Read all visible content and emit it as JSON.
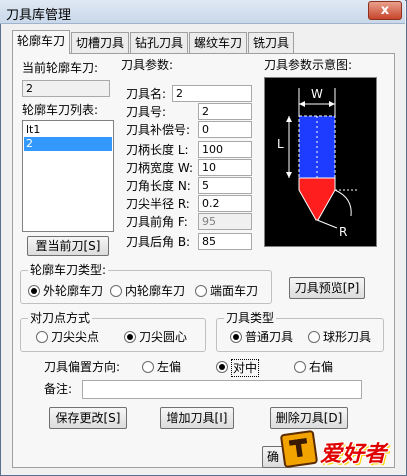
{
  "window": {
    "title": "刀具库管理",
    "close_glyph": "x"
  },
  "tabs": [
    {
      "label": "轮廓车刀"
    },
    {
      "label": "切槽刀具"
    },
    {
      "label": "钻孔刀具"
    },
    {
      "label": "螺纹车刀"
    },
    {
      "label": "铣刀具"
    }
  ],
  "current_tool": {
    "label": "当前轮廓车刀:",
    "value": "2"
  },
  "tool_list": {
    "label": "轮廓车刀列表:",
    "items": [
      "lt1",
      "2"
    ],
    "selected_index": 1
  },
  "set_current_button": "置当前刀[S]",
  "params": {
    "label": "刀具参数:",
    "fields": [
      {
        "label": "刀具名:",
        "value": "2",
        "disabled": false
      },
      {
        "label": "刀具号:",
        "value": "2",
        "disabled": false
      },
      {
        "label": "刀具补偿号:",
        "value": "0",
        "disabled": false
      },
      {
        "label": "刀柄长度 L:",
        "value": "100",
        "disabled": false
      },
      {
        "label": "刀柄宽度 W:",
        "value": "10",
        "disabled": false
      },
      {
        "label": "刀角长度 N:",
        "value": "5",
        "disabled": false
      },
      {
        "label": "刀尖半径 R:",
        "value": "0.2",
        "disabled": false
      },
      {
        "label": "刀具前角 F:",
        "value": "95",
        "disabled": true
      },
      {
        "label": "刀具后角 B:",
        "value": "85",
        "disabled": false
      }
    ]
  },
  "diagram": {
    "label": "刀具参数示意图:",
    "letters": {
      "w": "W",
      "l": "L",
      "r": "R"
    }
  },
  "tool_type": {
    "label": "轮廓车刀类型:",
    "options": [
      "外轮廓车刀",
      "内轮廓车刀",
      "端面车刀"
    ],
    "selected_index": 0
  },
  "preview_button": "刀具预览[P]",
  "tool_point": {
    "label": "对刀点方式",
    "options": [
      "刀尖尖点",
      "刀尖圆心"
    ],
    "selected_index": 1
  },
  "tool_kind": {
    "label": "刀具类型",
    "options": [
      "普通刀具",
      "球形刀具"
    ],
    "selected_index": 0
  },
  "offset_dir": {
    "label": "刀具偏置方向:",
    "options": [
      "左偏",
      "对中",
      "右偏"
    ],
    "selected_index": 1
  },
  "remark": {
    "label": "备注:",
    "value": ""
  },
  "buttons": {
    "save": "保存更改[S]",
    "add": "增加刀具[I]",
    "delete": "删除刀具[D]",
    "ok": "确"
  },
  "watermark": "爱好者",
  "colors": {
    "diagram_bg": "#000000",
    "shank_blue": "#1e3cff",
    "tip_red": "#ff1e1e",
    "selection": "#3399ff"
  }
}
